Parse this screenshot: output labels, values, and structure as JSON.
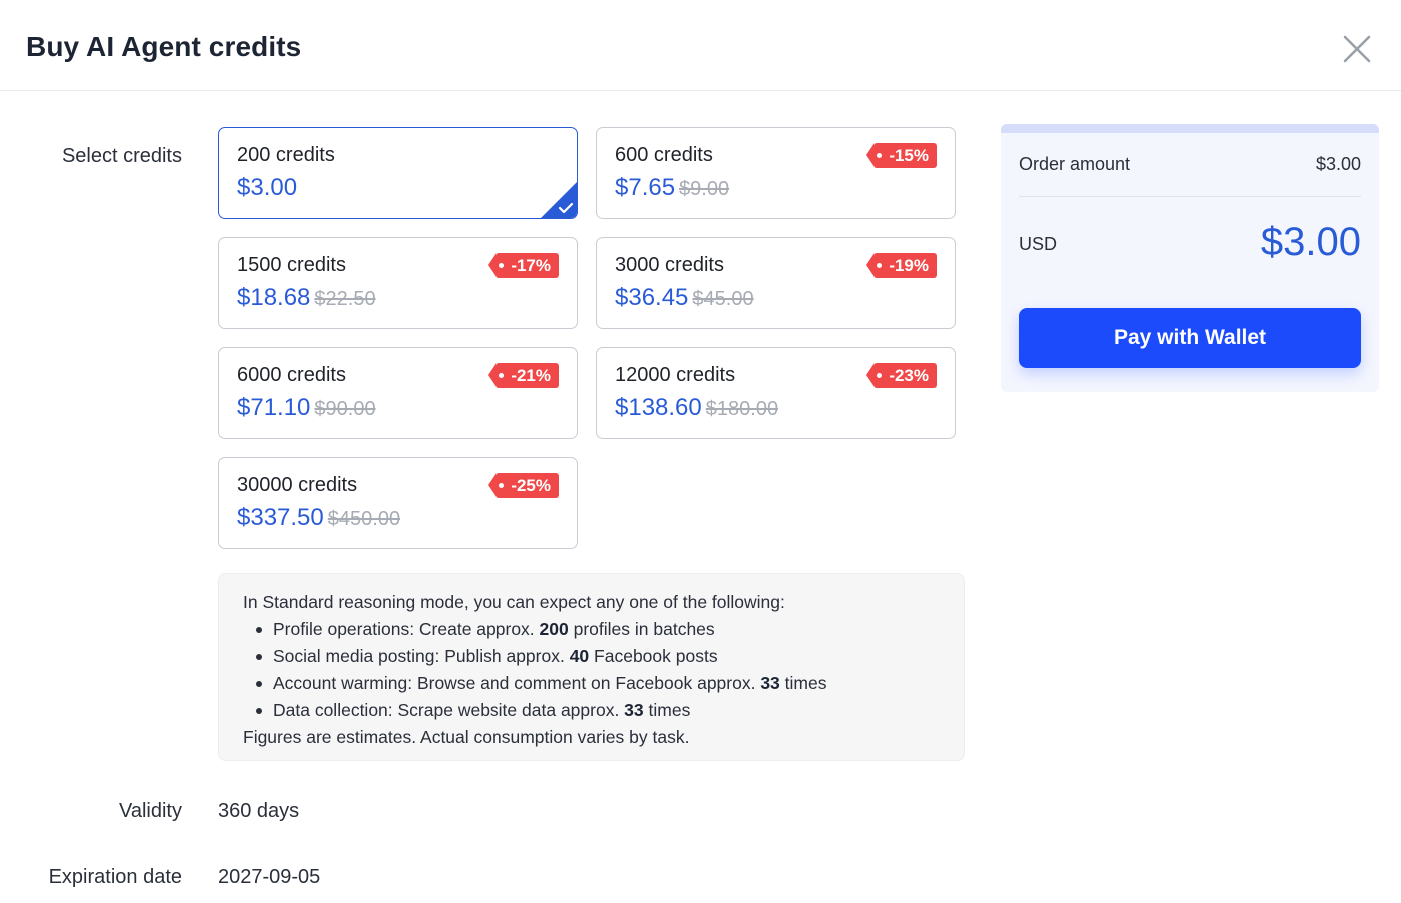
{
  "dialog": {
    "title": "Buy AI Agent credits"
  },
  "labels": {
    "select_credits": "Select credits",
    "validity": "Validity",
    "expiration_date": "Expiration date"
  },
  "packages": [
    {
      "credits": "200 credits",
      "price": "$3.00",
      "original": "",
      "discount": "",
      "selected": true
    },
    {
      "credits": "600 credits",
      "price": "$7.65",
      "original": "$9.00",
      "discount": "-15%",
      "selected": false
    },
    {
      "credits": "1500 credits",
      "price": "$18.68",
      "original": "$22.50",
      "discount": "-17%",
      "selected": false
    },
    {
      "credits": "3000 credits",
      "price": "$36.45",
      "original": "$45.00",
      "discount": "-19%",
      "selected": false
    },
    {
      "credits": "6000 credits",
      "price": "$71.10",
      "original": "$90.00",
      "discount": "-21%",
      "selected": false
    },
    {
      "credits": "12000 credits",
      "price": "$138.60",
      "original": "$180.00",
      "discount": "-23%",
      "selected": false
    },
    {
      "credits": "30000 credits",
      "price": "$337.50",
      "original": "$450.00",
      "discount": "-25%",
      "selected": false
    }
  ],
  "info": {
    "intro": "In Standard reasoning mode, you can expect any one of the following:",
    "items": [
      {
        "before": "Profile operations: Create approx. ",
        "value": "200",
        "after": " profiles in batches"
      },
      {
        "before": "Social media posting: Publish approx. ",
        "value": "40",
        "after": " Facebook posts"
      },
      {
        "before": "Account warming: Browse and comment on Facebook approx. ",
        "value": "33",
        "after": " times"
      },
      {
        "before": "Data collection: Scrape website data approx. ",
        "value": "33",
        "after": " times"
      }
    ],
    "footer": "Figures are estimates. Actual consumption varies by task."
  },
  "validity": "360 days",
  "expiration_date": "2027-09-05",
  "order": {
    "amount_label": "Order amount",
    "amount_value": "$3.00",
    "currency": "USD",
    "total": "$3.00",
    "pay_label": "Pay with Wallet"
  },
  "colors": {
    "accent": "#2a5bd7",
    "pay_button": "#1b4bfa",
    "discount_badge": "#f04848"
  }
}
